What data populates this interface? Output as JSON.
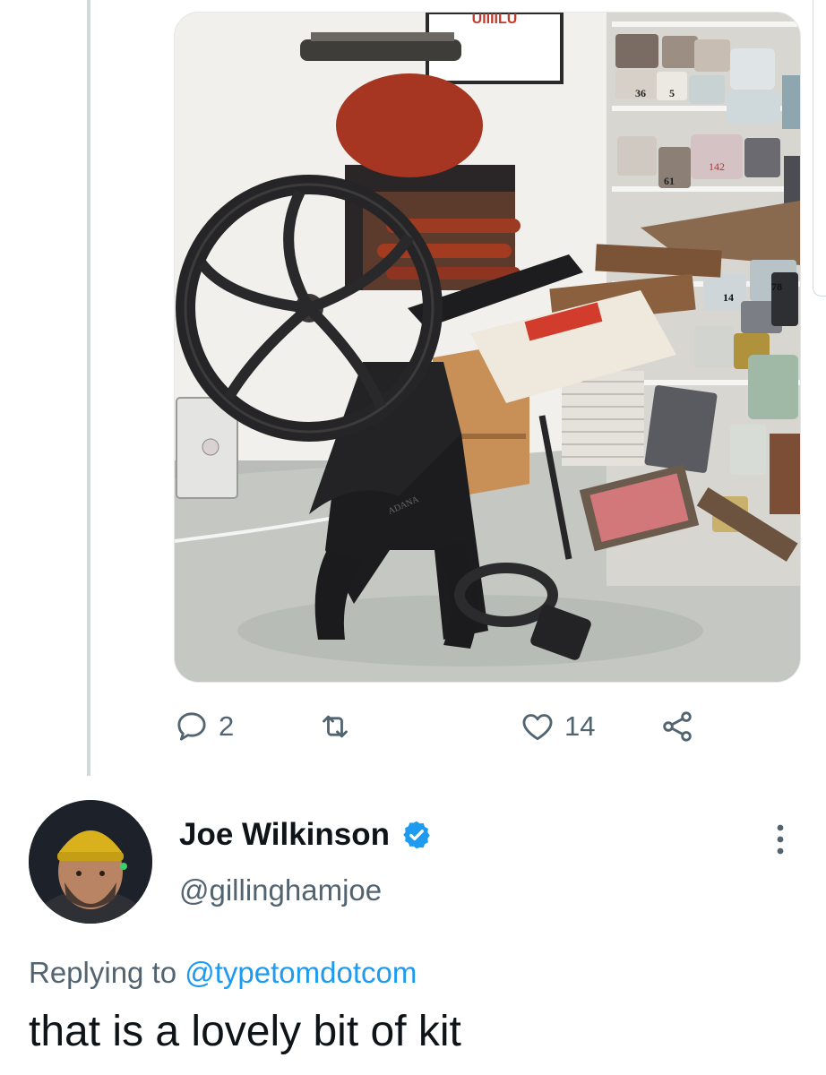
{
  "tweet": {
    "media": {
      "poster_text": "UIIIILU",
      "tin_labels": [
        "36",
        "5",
        "61",
        "142",
        "78",
        "14"
      ],
      "press_plaque": "ADANA"
    },
    "actions": {
      "reply_count": "2",
      "retweet_count": "",
      "like_count": "14"
    }
  },
  "reply": {
    "author_name": "Joe Wilkinson",
    "author_handle": "@gillinghamjoe",
    "replying_prefix": "Replying to ",
    "replying_to": "@typetomdotcom",
    "text": "that is a lovely bit of kit"
  },
  "icons": {
    "reply": "speech-bubble-icon",
    "retweet": "retweet-arrows-icon",
    "like": "heart-icon",
    "share": "share-nodes-icon",
    "verified": "verified-badge-icon",
    "more": "vertical-dots-icon"
  },
  "colors": {
    "accent": "#1d9bf0",
    "secondary_text": "#536471",
    "primary_text": "#0f1419",
    "thread_line": "#cfd9de"
  }
}
